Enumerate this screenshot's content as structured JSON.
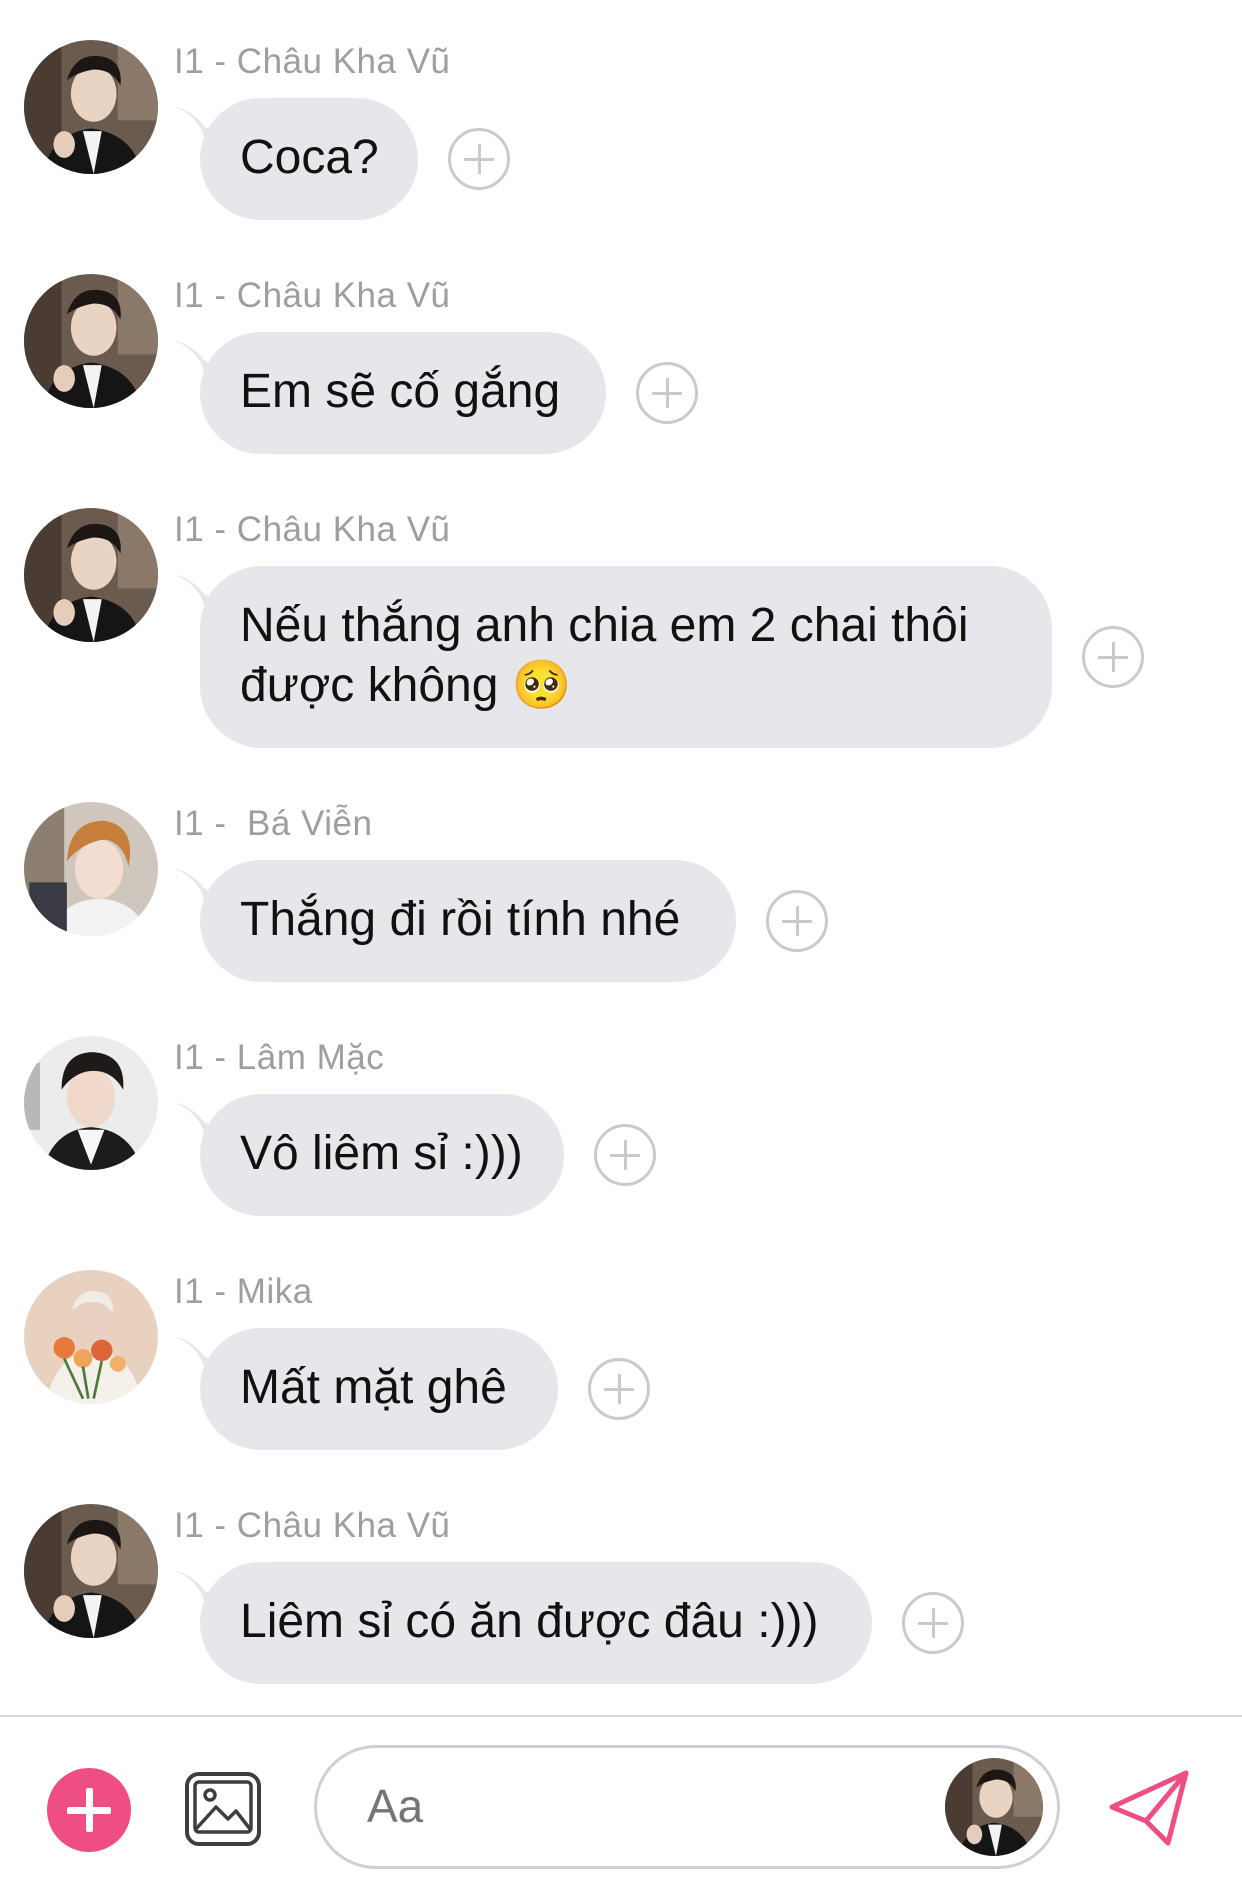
{
  "messages": [
    {
      "sender": "I1 - Châu Kha Vũ",
      "lines": [
        "Coca?"
      ],
      "avatar": "avatar-chau-kha-vu"
    },
    {
      "sender": "I1 - Châu Kha Vũ",
      "lines": [
        "Em sẽ cố gắng"
      ],
      "avatar": "avatar-chau-kha-vu"
    },
    {
      "sender": "I1 - Châu Kha Vũ",
      "lines": [
        "Nếu thắng anh chia em 2 chai thôi",
        "được không 🥺"
      ],
      "avatar": "avatar-chau-kha-vu"
    },
    {
      "sender": "I1 -  Bá Viễn",
      "lines": [
        "Thắng đi rồi tính nhé"
      ],
      "avatar": "avatar-ba-vien"
    },
    {
      "sender": "I1 - Lâm Mặc",
      "lines": [
        "Vô liêm sỉ :)))"
      ],
      "avatar": "avatar-lam-mac"
    },
    {
      "sender": "I1 - Mika",
      "lines": [
        "Mất mặt ghê"
      ],
      "avatar": "avatar-mika"
    },
    {
      "sender": "I1 - Châu Kha Vũ",
      "lines": [
        "Liêm sỉ có ăn được đâu :)))"
      ],
      "avatar": "avatar-chau-kha-vu"
    }
  ],
  "icons": {
    "react": "add-reaction-icon",
    "plus": "plus-icon",
    "image": "image-icon",
    "send": "send-icon"
  },
  "composer": {
    "placeholder": "Aa"
  },
  "colors": {
    "accent": "#ee4e84",
    "bubble": "#e6e7ea",
    "sender_text": "#9e9ea2"
  }
}
